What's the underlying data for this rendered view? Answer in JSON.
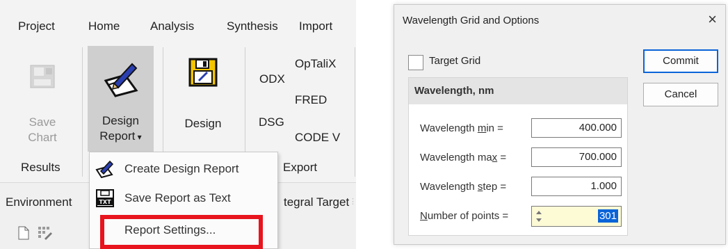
{
  "ribbon": {
    "tabs": [
      "Project",
      "Home",
      "Analysis",
      "Synthesis",
      "Import"
    ],
    "save_chart": {
      "line1": "Save",
      "line2": "Chart"
    },
    "design_report": {
      "line1": "Design",
      "line2": "Report"
    },
    "design": "Design",
    "odx": "ODX",
    "dsg": "DSG",
    "optalix": "OpTaliX",
    "fred": "FRED",
    "codev": "CODE V",
    "groups": {
      "results": "Results",
      "export": "Export"
    }
  },
  "environment": {
    "tab1": "Environment",
    "tab2": "tegral Target"
  },
  "menu": {
    "items": [
      "Create Design Report",
      "Save Report as Text",
      "Report Settings..."
    ]
  },
  "dialog": {
    "title": "Wavelength Grid and Options",
    "close": "×",
    "target_grid": "Target Grid",
    "group_title": "Wavelength, nm",
    "fields": {
      "min": {
        "label_pre": "Wavelength ",
        "label_ul": "m",
        "label_post": "in =",
        "value": "400.000"
      },
      "max": {
        "label_pre": "Wavelength ma",
        "label_ul": "x",
        "label_post": " =",
        "value": "700.000"
      },
      "step": {
        "label_pre": "Wavelength ",
        "label_ul": "s",
        "label_post": "tep =",
        "value": "1.000"
      },
      "points": {
        "label_pre": "",
        "label_ul": "N",
        "label_post": "umber of points =",
        "value": "301"
      }
    },
    "commit": "Commit",
    "cancel": "Cancel"
  },
  "colors": {
    "highlight": "#e8141e",
    "selection": "#0a64d8",
    "stepper_bg": "#fdfbd6"
  }
}
